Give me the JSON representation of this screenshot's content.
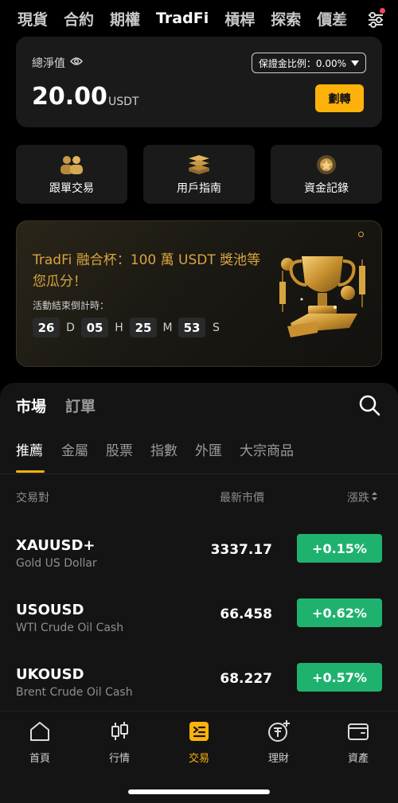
{
  "topnav": {
    "tabs": [
      "現貨",
      "合約",
      "期權",
      "TradFi",
      "槓桿",
      "探索",
      "價差"
    ],
    "active": "TradFi"
  },
  "balance": {
    "label": "總淨值",
    "amount": "20.00",
    "unit": "USDT",
    "margin_ratio": "保證金比例：0.00%",
    "transfer_label": "劃轉"
  },
  "quick_actions": [
    {
      "label": "跟單交易",
      "icon": "copy-trading-icon"
    },
    {
      "label": "用戶指南",
      "icon": "user-guide-icon"
    },
    {
      "label": "資金記錄",
      "icon": "fund-record-icon"
    }
  ],
  "promo": {
    "title": "TradFi 融合杯：100 萬 USDT 獎池等您瓜分！",
    "countdown_label": "活動結束倒計時：",
    "countdown": [
      {
        "value": "26",
        "unit": "D"
      },
      {
        "value": "05",
        "unit": "H"
      },
      {
        "value": "25",
        "unit": "M"
      },
      {
        "value": "53",
        "unit": "S"
      }
    ]
  },
  "market": {
    "tabs": [
      "市場",
      "訂單"
    ],
    "categories": [
      "推薦",
      "金屬",
      "股票",
      "指數",
      "外匯",
      "大宗商品"
    ],
    "columns": {
      "pair": "交易對",
      "price": "最新市價",
      "change": "漲跌"
    },
    "rows": [
      {
        "symbol": "XAUUSD+",
        "desc": "Gold US Dollar",
        "price": "3337.17",
        "change": "+0.15%"
      },
      {
        "symbol": "USOUSD",
        "desc": "WTI Crude Oil Cash",
        "price": "66.458",
        "change": "+0.62%"
      },
      {
        "symbol": "UKOUSD",
        "desc": "Brent Crude Oil Cash",
        "price": "68.227",
        "change": "+0.57%"
      }
    ]
  },
  "bottomnav": [
    {
      "label": "首頁",
      "icon": "home-icon"
    },
    {
      "label": "行情",
      "icon": "candlestick-icon"
    },
    {
      "label": "交易",
      "icon": "trade-icon"
    },
    {
      "label": "理財",
      "icon": "earn-icon"
    },
    {
      "label": "資產",
      "icon": "wallet-icon"
    }
  ],
  "colors": {
    "accent": "#fcb20a",
    "positive": "#1fb26f",
    "promo_text": "#d9a441",
    "notification": "#f6465d"
  }
}
